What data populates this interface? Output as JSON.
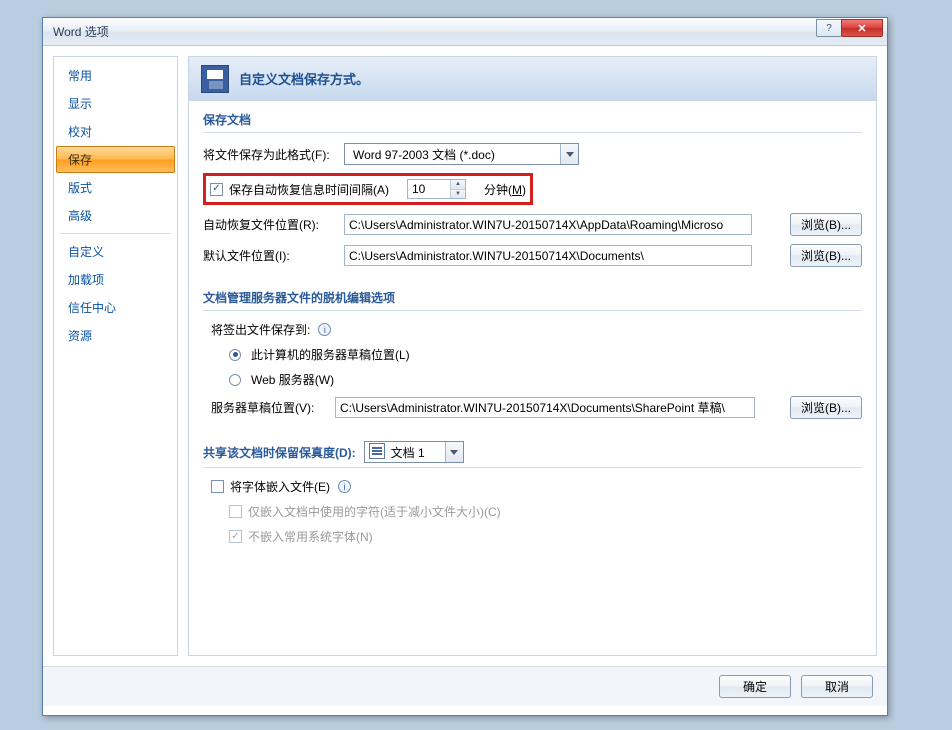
{
  "titlebar": {
    "title": "Word 选项"
  },
  "sidebar": {
    "items": [
      "常用",
      "显示",
      "校对",
      "保存",
      "版式",
      "高级",
      "自定义",
      "加载项",
      "信任中心",
      "资源"
    ],
    "selected_index": 3
  },
  "header": {
    "text": "自定义文档保存方式。"
  },
  "save_section": {
    "title": "保存文档",
    "format_label": "将文件保存为此格式(F):",
    "format_value": "Word 97-2003 文档 (*.doc)",
    "autorecover_label": "保存自动恢复信息时间间隔(A)",
    "autorecover_value": "10",
    "minutes_label": "分钟(M)",
    "autorecover_loc_label": "自动恢复文件位置(R):",
    "autorecover_loc_value": "C:\\Users\\Administrator.WIN7U-20150714X\\AppData\\Roaming\\Microso",
    "default_loc_label": "默认文件位置(I):",
    "default_loc_value": "C:\\Users\\Administrator.WIN7U-20150714X\\Documents\\",
    "browse_label": "浏览(B)..."
  },
  "offline_section": {
    "title": "文档管理服务器文件的脱机编辑选项",
    "checkout_label": "将签出文件保存到:",
    "radio1": "此计算机的服务器草稿位置(L)",
    "radio2": "Web 服务器(W)",
    "draft_loc_label": "服务器草稿位置(V):",
    "draft_loc_value": "C:\\Users\\Administrator.WIN7U-20150714X\\Documents\\SharePoint 草稿\\",
    "browse_label": "浏览(B)..."
  },
  "fidelity_section": {
    "title": "共享该文档时保留保真度(D):",
    "doc_name": "文档 1",
    "embed_fonts": "将字体嵌入文件(E)",
    "embed_used_only": "仅嵌入文档中使用的字符(适于减小文件大小)(C)",
    "no_common_sys": "不嵌入常用系统字体(N)"
  },
  "footer": {
    "ok": "确定",
    "cancel": "取消"
  }
}
